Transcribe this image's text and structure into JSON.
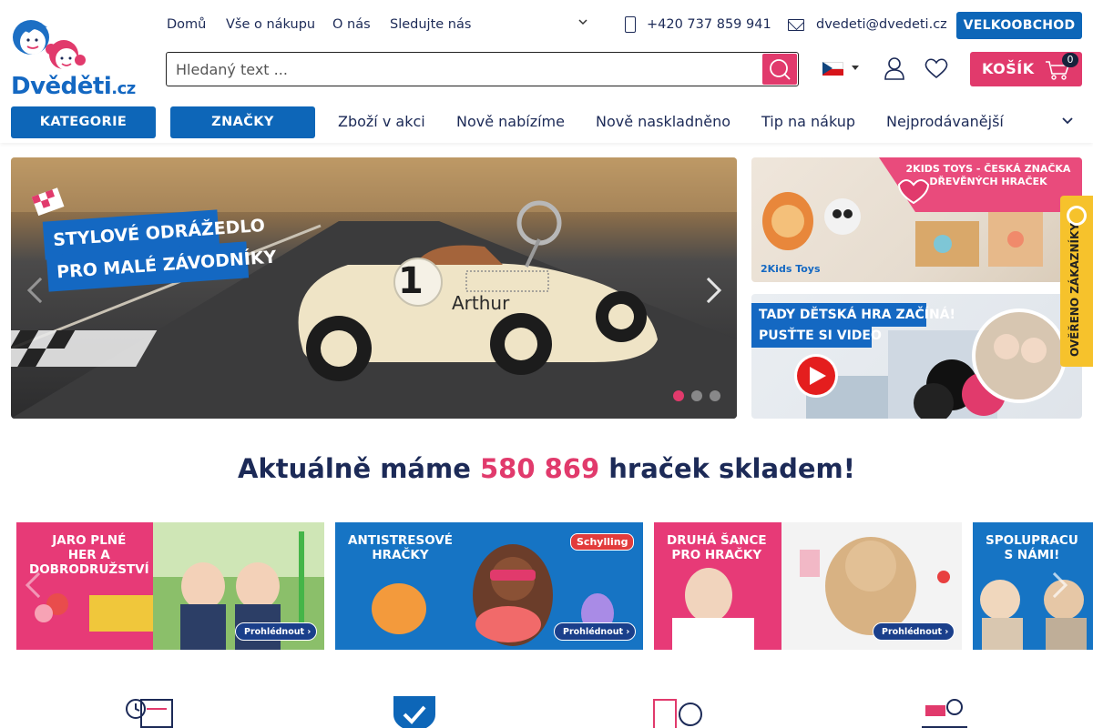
{
  "header": {
    "logo_text": "Dvěděti",
    "logo_tld": ".cz",
    "nav": [
      "Domů",
      "Vše o nákupu",
      "O nás",
      "Sledujte nás"
    ],
    "phone": "+420 737 859 941",
    "email": "dvedeti@dvedeti.cz",
    "wholesale_label": "VELKOOBCHOD",
    "search_placeholder": "Hledaný text ...",
    "cart_label": "KOŠÍK",
    "cart_count": "0",
    "categories_label": "KATEGORIE",
    "brands_label": "ZNAČKY",
    "category_links": [
      "Zboží v akci",
      "Nově nabízíme",
      "Nově naskladněno",
      "Tip na nákup",
      "Nejprodávanější"
    ]
  },
  "hero": {
    "tagline_1": "STYLOVÉ ODRÁŽEDLO",
    "tagline_2": "PRO MALÉ ZÁVODNÍKY",
    "car_number": "1",
    "car_name": "Arthur",
    "active_slide": 1,
    "slide_count": 3
  },
  "side_banners": {
    "kids_title_1": "2KIDS TOYS - ČESKÁ ZNAČKA",
    "kids_title_2": "DŘEVĚNÝCH HRAČEK",
    "kids_logo": "2Kids Toys",
    "video_title_1": "TADY DĚTSKÁ HRA ZAČÍNÁ!",
    "video_title_2": "PUSŤTE SI VIDEO"
  },
  "trust_badge": "OVĚŘENO ZÁKAZNÍKY",
  "headline": {
    "prefix": "Aktuálně máme ",
    "count": "580 869",
    "suffix": " hraček skladem!"
  },
  "promos": [
    {
      "title": "JARO PLNÉ\nHER A\nDOBRODRUŽSTVÍ",
      "button": "Prohlédnout",
      "brand": ""
    },
    {
      "title": "ANTISTRESOVÉ\nHRAČKY",
      "button": "Prohlédnout",
      "brand": "Schylling"
    },
    {
      "title": "DRUHÁ ŠANCE\nPRO HRAČKY",
      "button": "Prohlédnout",
      "brand": ""
    },
    {
      "title": "SPOLUPRACU\nS NÁMI!",
      "button": "",
      "brand": ""
    }
  ],
  "colors": {
    "primary_blue": "#0d66b8",
    "accent_pink": "#e13a6c",
    "text_navy": "#1c2a57",
    "trust_yellow": "#f6c22c"
  },
  "icons": [
    "phone-icon",
    "mail-icon",
    "search-icon",
    "user-icon",
    "heart-icon",
    "cart-icon",
    "chevron-down-icon"
  ]
}
